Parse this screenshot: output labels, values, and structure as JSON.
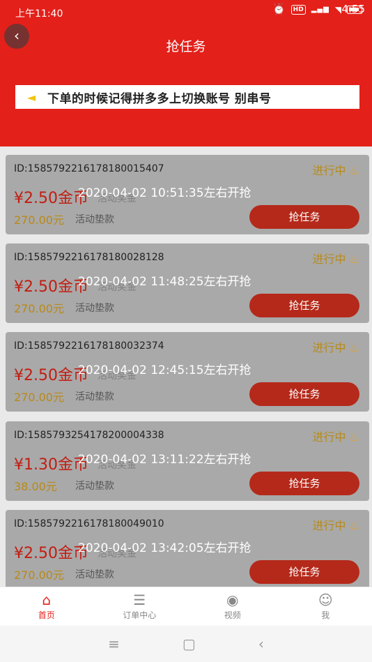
{
  "status_bar": {
    "time": "上午11:40",
    "overlay_time": "4:55"
  },
  "header": {
    "back_icon": "chevron-left-icon",
    "title": "抢任务",
    "notice_icon": "megaphone-icon",
    "notice_text": "下单的时候记得拼多多上切换账号 别串号"
  },
  "cards": [
    {
      "id": "ID:1585792216178180015407",
      "status": "进行中",
      "price": "¥2.50金币",
      "price_tag": "活动奖金",
      "amount": "270.00元",
      "amount_tag": "活动垫款",
      "time": "2020-04-02 10:51:35左右开抢",
      "button": "抢任务"
    },
    {
      "id": "ID:1585792216178180028128",
      "status": "进行中",
      "price": "¥2.50金币",
      "price_tag": "活动奖金",
      "amount": "270.00元",
      "amount_tag": "活动垫款",
      "time": "2020-04-02 11:48:25左右开抢",
      "button": "抢任务"
    },
    {
      "id": "ID:1585792216178180032374",
      "status": "进行中",
      "price": "¥2.50金币",
      "price_tag": "活动奖金",
      "amount": "270.00元",
      "amount_tag": "活动垫款",
      "time": "2020-04-02 12:45:15左右开抢",
      "button": "抢任务"
    },
    {
      "id": "ID:1585793254178200004338",
      "status": "进行中",
      "price": "¥1.30金币",
      "price_tag": "活动奖金",
      "amount": "38.00元",
      "amount_tag": "活动垫款",
      "time": "2020-04-02 13:11:22左右开抢",
      "button": "抢任务"
    },
    {
      "id": "ID:1585792216178180049010",
      "status": "进行中",
      "price": "¥2.50金币",
      "price_tag": "活动奖金",
      "amount": "270.00元",
      "amount_tag": "活动垫款",
      "time": "2020-04-02 13:42:05左右开抢",
      "button": "抢任务"
    }
  ],
  "tabbar": {
    "items": [
      {
        "label": "首页",
        "icon": "home-icon",
        "active": true
      },
      {
        "label": "订单中心",
        "icon": "order-icon",
        "active": false
      },
      {
        "label": "视频",
        "icon": "video-icon",
        "active": false
      },
      {
        "label": "我",
        "icon": "user-icon",
        "active": false
      }
    ]
  },
  "colors": {
    "primary": "#e3201a",
    "gold": "#b98917",
    "button": "#b5291a"
  }
}
